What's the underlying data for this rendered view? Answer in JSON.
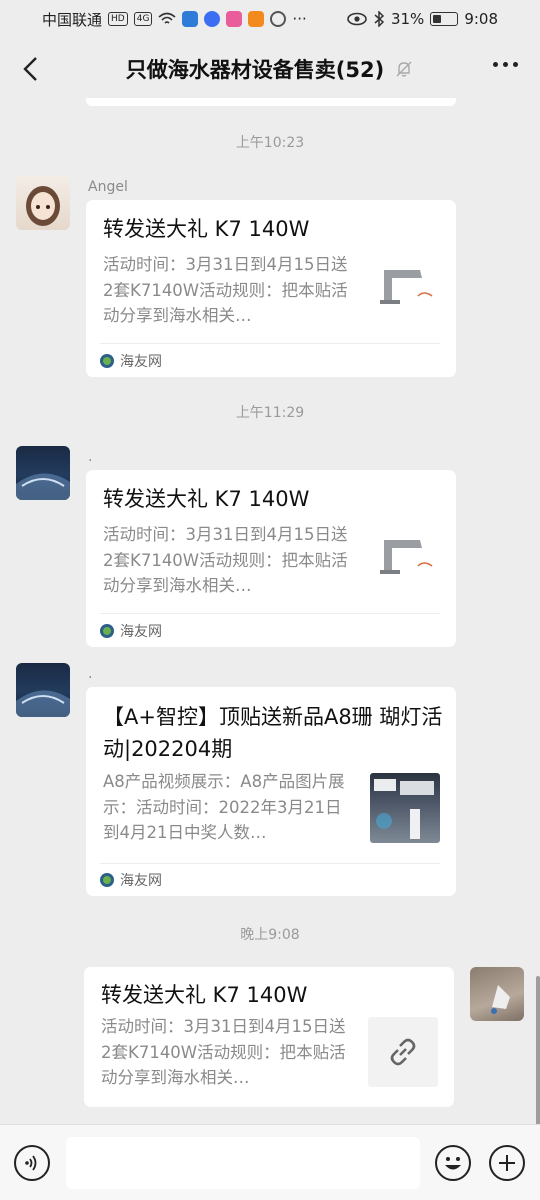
{
  "status_bar": {
    "carrier": "中国联通",
    "network": "HD",
    "signal": "4G",
    "battery": "31%",
    "time": "9:08"
  },
  "header": {
    "title": "只做海水器材设备售卖(52)"
  },
  "timestamps": [
    "上午10:23",
    "上午11:29",
    "晚上9:08"
  ],
  "messages": [
    {
      "sender": "Angel",
      "title": "转发送大礼 K7 140W",
      "desc": "活动时间：3月31日到4月15日送2套K7140W活动规则：把本贴活动分享到海水相关…",
      "source": "海友网",
      "thumb_icon": "lamp-thumbnail"
    },
    {
      "sender": ".",
      "title": "转发送大礼 K7 140W",
      "desc": "活动时间：3月31日到4月15日送2套K7140W活动规则：把本贴活动分享到海水相关…",
      "source": "海友网",
      "thumb_icon": "lamp-thumbnail"
    },
    {
      "sender": ".",
      "title": "【A+智控】顶贴送新品A8珊 瑚灯活动|202204期",
      "desc": "A8产品视频展示：A8产品图片展示：活动时间：2022年3月21日到4月21日中奖人数…",
      "source": "海友网",
      "thumb_icon": "a8-product-thumbnail"
    },
    {
      "sender": "",
      "title": "转发送大礼 K7 140W",
      "desc": "活动时间：3月31日到4月15日送2套K7140W活动规则：把本贴活动分享到海水相关…",
      "thumb_icon": "link-icon"
    }
  ],
  "input": {
    "placeholder": ""
  },
  "colors": {
    "background": "#ededed",
    "bubble": "#ffffff",
    "muted_text": "#8a8a8a"
  }
}
